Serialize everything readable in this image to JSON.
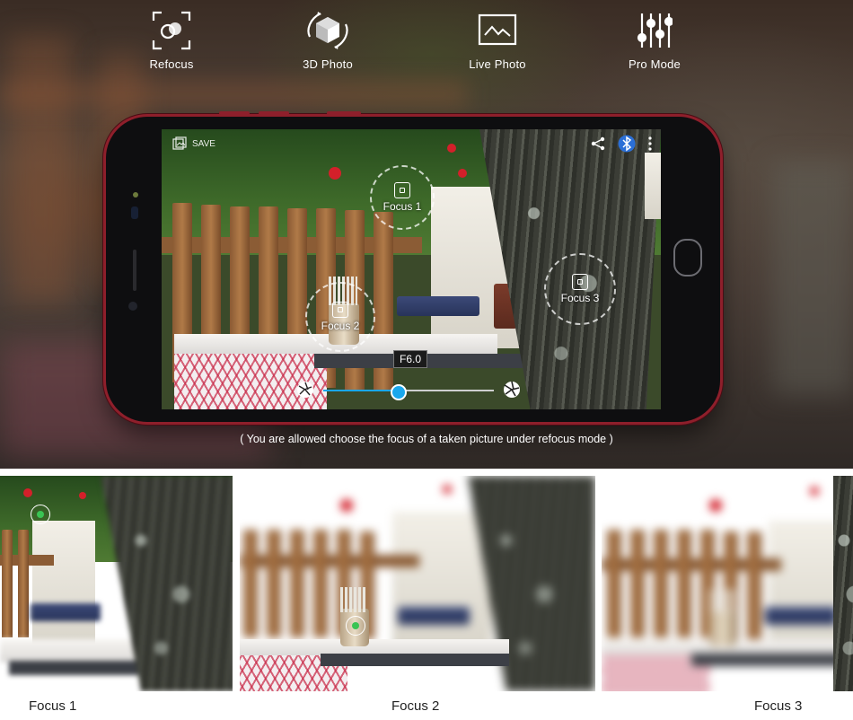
{
  "features": [
    {
      "label": "Refocus",
      "icon": "refocus-icon"
    },
    {
      "label": "3D Photo",
      "icon": "3d-cube-icon"
    },
    {
      "label": "Live Photo",
      "icon": "live-photo-icon"
    },
    {
      "label": "Pro Mode",
      "icon": "sliders-icon"
    }
  ],
  "camera_ui": {
    "save_label": "SAVE",
    "focus_points": [
      "Focus 1",
      "Focus 2",
      "Focus 3"
    ],
    "aperture_value": "F6.0",
    "aperture_level": 0.44
  },
  "caption": "( You are allowed choose the focus of a taken picture under refocus mode )",
  "thumbnails": [
    {
      "label": "Focus 1"
    },
    {
      "label": "Focus 2"
    },
    {
      "label": "Focus 3"
    }
  ],
  "colors": {
    "phone_frame": "#8e1f2b",
    "slider_accent": "#1aa7ec",
    "focus_marker": "#3ac454"
  }
}
